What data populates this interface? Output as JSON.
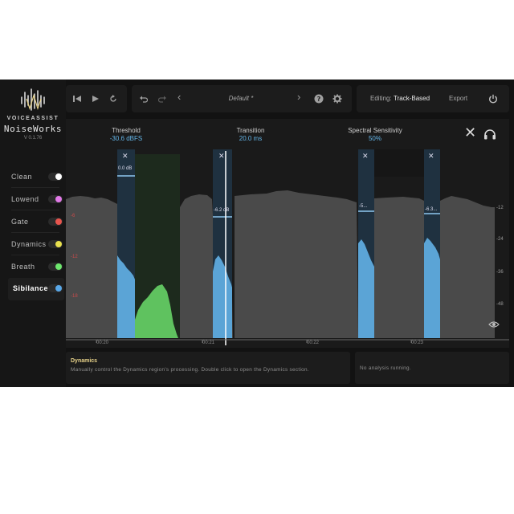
{
  "brand": {
    "top": "VOICEASSIST",
    "name": "NoiseWorks",
    "version": "V 0.1.76"
  },
  "sidebar": {
    "items": [
      {
        "label": "Clean",
        "color": "#ffffff",
        "active": false
      },
      {
        "label": "Lowend",
        "color": "#e27ae8",
        "active": false
      },
      {
        "label": "Gate",
        "color": "#e8554e",
        "active": false
      },
      {
        "label": "Dynamics",
        "color": "#e8e04e",
        "active": false
      },
      {
        "label": "Breath",
        "color": "#6ee86e",
        "active": false
      },
      {
        "label": "Sibilance",
        "color": "#59a8e8",
        "active": true
      }
    ]
  },
  "toolbar": {
    "preset": "Default *",
    "editing_label": "Editing:",
    "editing_value": "Track-Based",
    "export_label": "Export"
  },
  "params": {
    "threshold": {
      "label": "Threshold",
      "value": "-30.6 dBFS"
    },
    "transition": {
      "label": "Transition",
      "value": "20.0 ms"
    },
    "sensitivity": {
      "label": "Spectral Sensitivity",
      "value": "50%"
    }
  },
  "bands": [
    {
      "value": "0.0 dB"
    },
    {
      "value": "-6.2 dB"
    },
    {
      "value": "-5..."
    },
    {
      "value": "-6.3..."
    }
  ],
  "scale_left": [
    "-6",
    "-12",
    "-18"
  ],
  "scale_right": [
    "-12",
    "-24",
    "-36",
    "-48"
  ],
  "timeline": [
    "00:20",
    "00:21",
    "00:22",
    "00:23"
  ],
  "info_panel": {
    "title": "Dynamics",
    "text": "Manually control the Dynamics region's processing. Double click to open the Dynamics section."
  },
  "status_panel": {
    "text": "No analysis running."
  },
  "colors": {
    "accent": "#64b5e8",
    "wave": "#4a4a4a",
    "band": "#5ba4d6",
    "green": "#5fc25f",
    "warning": "#c94a4a"
  }
}
